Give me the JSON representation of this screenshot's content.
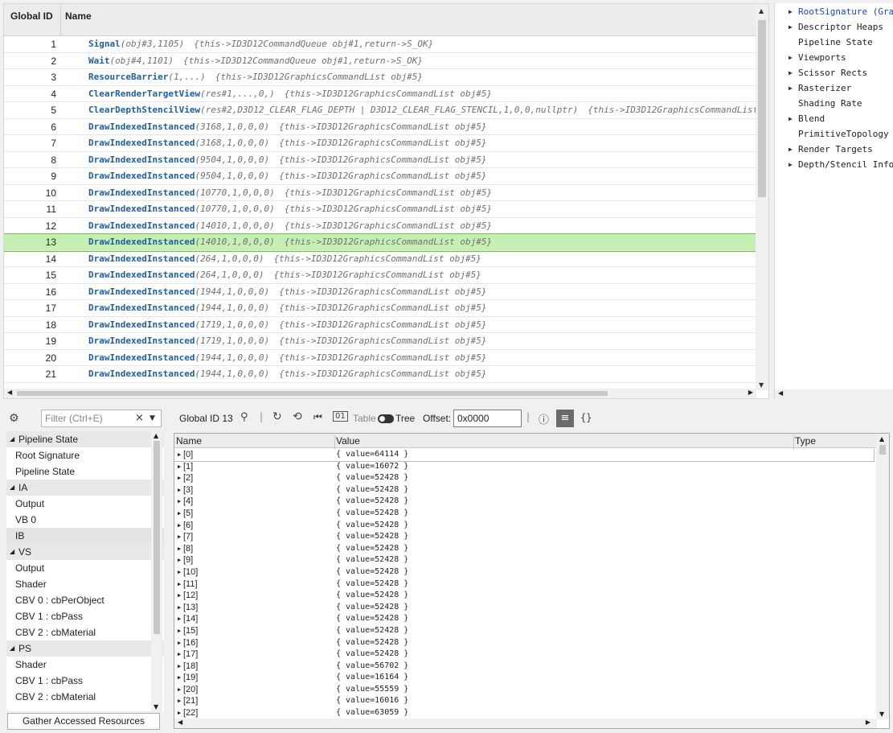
{
  "events": {
    "header": {
      "id_label": "Global ID",
      "name_label": "Name"
    },
    "rows": [
      {
        "id": "1",
        "fn": "Signal",
        "args": "(obj#3,1105)",
        "this": "{this->ID3D12CommandQueue obj#1,return->S_OK}"
      },
      {
        "id": "2",
        "fn": "Wait",
        "args": "(obj#4,1101)",
        "this": "{this->ID3D12CommandQueue obj#1,return->S_OK}"
      },
      {
        "id": "3",
        "fn": "ResourceBarrier",
        "args": "(1,...)",
        "this": "{this->ID3D12GraphicsCommandList obj#5}"
      },
      {
        "id": "4",
        "fn": "ClearRenderTargetView",
        "args": "(res#1,...,0,)",
        "this": "{this->ID3D12GraphicsCommandList obj#5}"
      },
      {
        "id": "5",
        "fn": "ClearDepthStencilView",
        "args": "(res#2,D3D12_CLEAR_FLAG_DEPTH | D3D12_CLEAR_FLAG_STENCIL,1,0,0,nullptr)",
        "this": "{this->ID3D12GraphicsCommandList"
      },
      {
        "id": "6",
        "fn": "DrawIndexedInstanced",
        "args": "(3168,1,0,0,0)",
        "this": "{this->ID3D12GraphicsCommandList obj#5}"
      },
      {
        "id": "7",
        "fn": "DrawIndexedInstanced",
        "args": "(3168,1,0,0,0)",
        "this": "{this->ID3D12GraphicsCommandList obj#5}"
      },
      {
        "id": "8",
        "fn": "DrawIndexedInstanced",
        "args": "(9504,1,0,0,0)",
        "this": "{this->ID3D12GraphicsCommandList obj#5}"
      },
      {
        "id": "9",
        "fn": "DrawIndexedInstanced",
        "args": "(9504,1,0,0,0)",
        "this": "{this->ID3D12GraphicsCommandList obj#5}"
      },
      {
        "id": "10",
        "fn": "DrawIndexedInstanced",
        "args": "(10770,1,0,0,0)",
        "this": "{this->ID3D12GraphicsCommandList obj#5}"
      },
      {
        "id": "11",
        "fn": "DrawIndexedInstanced",
        "args": "(10770,1,0,0,0)",
        "this": "{this->ID3D12GraphicsCommandList obj#5}"
      },
      {
        "id": "12",
        "fn": "DrawIndexedInstanced",
        "args": "(14010,1,0,0,0)",
        "this": "{this->ID3D12GraphicsCommandList obj#5}"
      },
      {
        "id": "13",
        "fn": "DrawIndexedInstanced",
        "args": "(14010,1,0,0,0)",
        "this": "{this->ID3D12GraphicsCommandList obj#5}",
        "selected": true
      },
      {
        "id": "14",
        "fn": "DrawIndexedInstanced",
        "args": "(264,1,0,0,0)",
        "this": "{this->ID3D12GraphicsCommandList obj#5}"
      },
      {
        "id": "15",
        "fn": "DrawIndexedInstanced",
        "args": "(264,1,0,0,0)",
        "this": "{this->ID3D12GraphicsCommandList obj#5}"
      },
      {
        "id": "16",
        "fn": "DrawIndexedInstanced",
        "args": "(1944,1,0,0,0)",
        "this": "{this->ID3D12GraphicsCommandList obj#5}"
      },
      {
        "id": "17",
        "fn": "DrawIndexedInstanced",
        "args": "(1944,1,0,0,0)",
        "this": "{this->ID3D12GraphicsCommandList obj#5}"
      },
      {
        "id": "18",
        "fn": "DrawIndexedInstanced",
        "args": "(1719,1,0,0,0)",
        "this": "{this->ID3D12GraphicsCommandList obj#5}"
      },
      {
        "id": "19",
        "fn": "DrawIndexedInstanced",
        "args": "(1719,1,0,0,0)",
        "this": "{this->ID3D12GraphicsCommandList obj#5}"
      },
      {
        "id": "20",
        "fn": "DrawIndexedInstanced",
        "args": "(1944,1,0,0,0)",
        "this": "{this->ID3D12GraphicsCommandList obj#5}"
      },
      {
        "id": "21",
        "fn": "DrawIndexedInstanced",
        "args": "(1944,1,0,0,0)",
        "this": "{this->ID3D12GraphicsCommandList obj#5}"
      }
    ]
  },
  "pipeline": {
    "items": [
      {
        "label": "RootSignature (Gra",
        "expandable": true,
        "link": true
      },
      {
        "label": "Descriptor Heaps",
        "expandable": true
      },
      {
        "label": "Pipeline State",
        "expandable": false
      },
      {
        "label": "Viewports",
        "expandable": true
      },
      {
        "label": "Scissor Rects",
        "expandable": true
      },
      {
        "label": "Rasterizer",
        "expandable": true
      },
      {
        "label": "Shading Rate",
        "expandable": false
      },
      {
        "label": "Blend",
        "expandable": true
      },
      {
        "label": "PrimitiveTopology",
        "expandable": false
      },
      {
        "label": "Render Targets",
        "expandable": true
      },
      {
        "label": "Depth/Stencil Info",
        "expandable": true
      }
    ]
  },
  "toolbar": {
    "filter_placeholder": "Filter (Ctrl+E)",
    "global_id_label": "Global ID 13",
    "table_label": "Table",
    "tree_label": "Tree",
    "offset_label": "Offset:",
    "offset_value": "0x0000",
    "braces_label": "{}",
    "sep": "|"
  },
  "resources": {
    "items": [
      {
        "label": "Pipeline State",
        "group": true
      },
      {
        "label": "Root Signature"
      },
      {
        "label": "Pipeline State"
      },
      {
        "label": "IA",
        "group": true
      },
      {
        "label": "Output"
      },
      {
        "label": "VB 0"
      },
      {
        "label": "IB",
        "highlight": true
      },
      {
        "label": "VS",
        "group": true
      },
      {
        "label": "Output"
      },
      {
        "label": "Shader"
      },
      {
        "label": "CBV 0 : cbPerObject"
      },
      {
        "label": "CBV 1 : cbPass"
      },
      {
        "label": "CBV 2 : cbMaterial"
      },
      {
        "label": "PS",
        "group": true
      },
      {
        "label": "Shader"
      },
      {
        "label": "CBV 1 : cbPass"
      },
      {
        "label": "CBV 2 : cbMaterial"
      }
    ],
    "gather_button": "Gather Accessed Resources"
  },
  "grid": {
    "headers": {
      "name": "Name",
      "value": "Value",
      "type": "Type"
    },
    "rows": [
      {
        "name": "[0]",
        "value": "{ value=64114 }",
        "selected": true
      },
      {
        "name": "[1]",
        "value": "{ value=16072 }"
      },
      {
        "name": "[2]",
        "value": "{ value=52428 }"
      },
      {
        "name": "[3]",
        "value": "{ value=52428 }"
      },
      {
        "name": "[4]",
        "value": "{ value=52428 }"
      },
      {
        "name": "[5]",
        "value": "{ value=52428 }"
      },
      {
        "name": "[6]",
        "value": "{ value=52428 }"
      },
      {
        "name": "[7]",
        "value": "{ value=52428 }"
      },
      {
        "name": "[8]",
        "value": "{ value=52428 }"
      },
      {
        "name": "[9]",
        "value": "{ value=52428 }"
      },
      {
        "name": "[10]",
        "value": "{ value=52428 }"
      },
      {
        "name": "[11]",
        "value": "{ value=52428 }"
      },
      {
        "name": "[12]",
        "value": "{ value=52428 }"
      },
      {
        "name": "[13]",
        "value": "{ value=52428 }"
      },
      {
        "name": "[14]",
        "value": "{ value=52428 }"
      },
      {
        "name": "[15]",
        "value": "{ value=52428 }"
      },
      {
        "name": "[16]",
        "value": "{ value=52428 }"
      },
      {
        "name": "[17]",
        "value": "{ value=52428 }"
      },
      {
        "name": "[18]",
        "value": "{ value=56702 }"
      },
      {
        "name": "[19]",
        "value": "{ value=16164 }"
      },
      {
        "name": "[20]",
        "value": "{ value=55559 }"
      },
      {
        "name": "[21]",
        "value": "{ value=16016 }"
      },
      {
        "name": "[22]",
        "value": "{ value=63059 }"
      }
    ]
  },
  "colors": {
    "selection_bg": "#c6efb4",
    "function_name": "#1f5f9f",
    "link": "#1a3fd0"
  }
}
